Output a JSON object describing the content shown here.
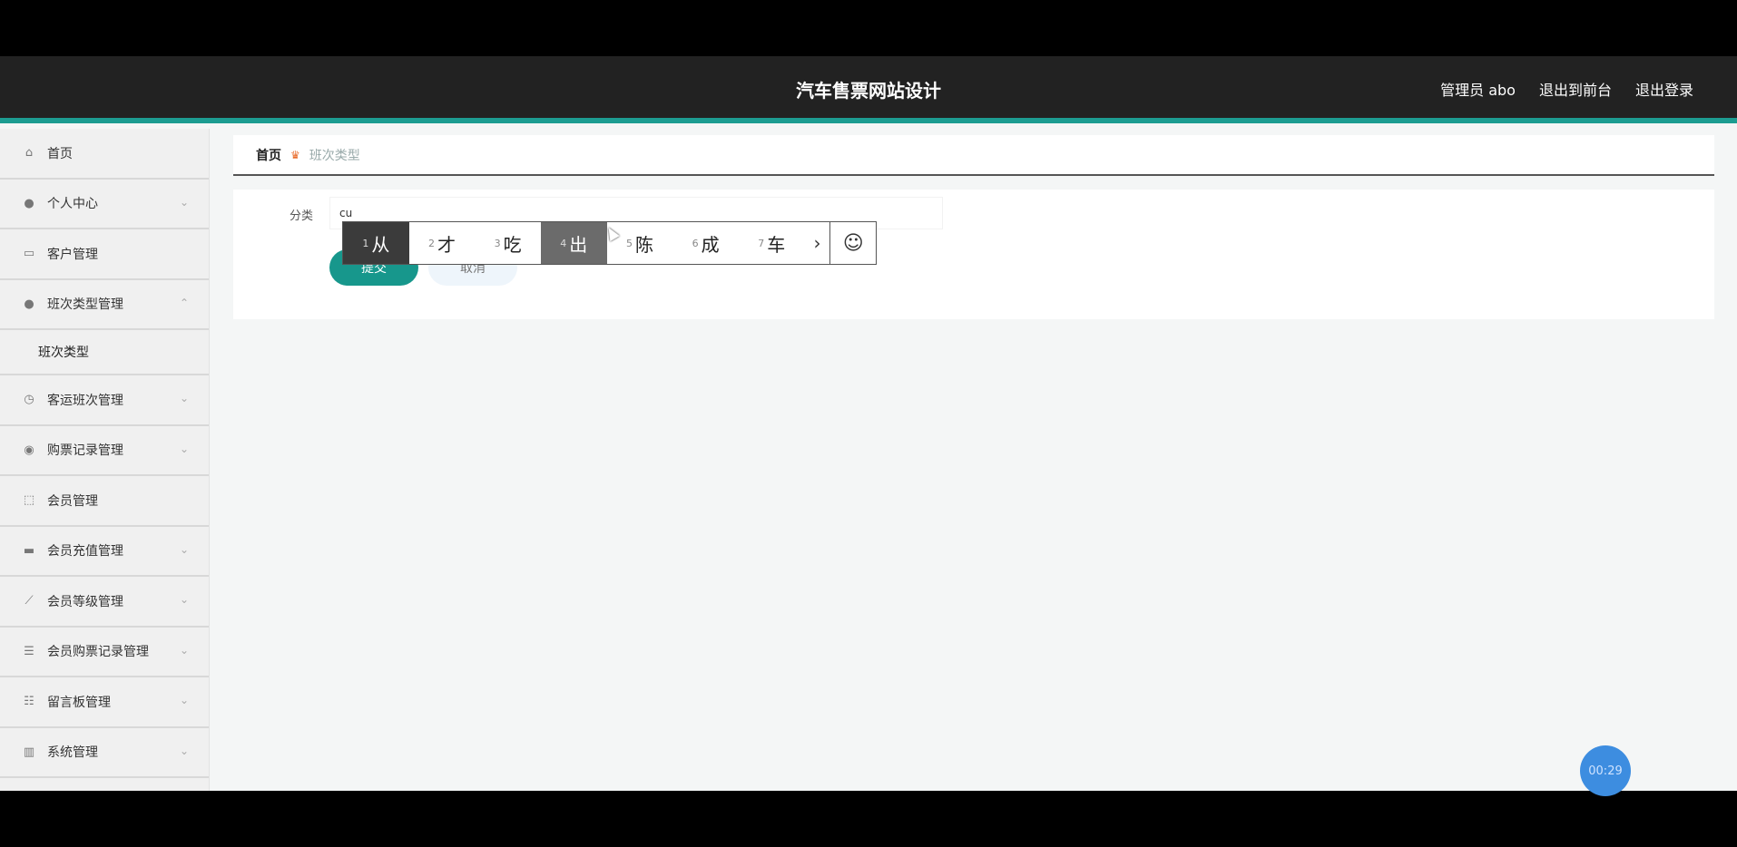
{
  "header": {
    "title": "汽车售票网站设计",
    "user_label": "管理员 abo",
    "front_link": "退出到前台",
    "logout_link": "退出登录"
  },
  "sidebar": {
    "items": [
      {
        "label": "首页",
        "icon": "home-icon",
        "chevron": false
      },
      {
        "label": "个人中心",
        "icon": "user-icon",
        "chevron": true
      },
      {
        "label": "客户管理",
        "icon": "grid-icon",
        "chevron": false
      },
      {
        "label": "班次类型管理",
        "icon": "user-icon",
        "chevron": true
      },
      {
        "label": "客运班次管理",
        "icon": "dashboard-icon",
        "chevron": true
      },
      {
        "label": "购票记录管理",
        "icon": "globe-icon",
        "chevron": true
      },
      {
        "label": "会员管理",
        "icon": "frame-icon",
        "chevron": false
      },
      {
        "label": "会员充值管理",
        "icon": "card-icon",
        "chevron": true
      },
      {
        "label": "会员等级管理",
        "icon": "chart-icon",
        "chevron": true
      },
      {
        "label": "会员购票记录管理",
        "icon": "list-icon",
        "chevron": true
      },
      {
        "label": "留言板管理",
        "icon": "sliders-icon",
        "chevron": true
      },
      {
        "label": "系统管理",
        "icon": "bar-chart-icon",
        "chevron": true
      }
    ],
    "submenu_label": "班次类型"
  },
  "breadcrumb": {
    "home": "首页",
    "current": "班次类型"
  },
  "form": {
    "category_label": "分类",
    "category_value": "cu",
    "submit_label": "提交",
    "cancel_label": "取消"
  },
  "ime": {
    "candidates": [
      {
        "num": "1",
        "char": "从"
      },
      {
        "num": "2",
        "char": "才"
      },
      {
        "num": "3",
        "char": "吃"
      },
      {
        "num": "4",
        "char": "出"
      },
      {
        "num": "5",
        "char": "陈"
      },
      {
        "num": "6",
        "char": "成"
      },
      {
        "num": "7",
        "char": "车"
      }
    ],
    "next_glyph": "›",
    "emoji_glyph": "☺"
  },
  "timer": "00:29"
}
